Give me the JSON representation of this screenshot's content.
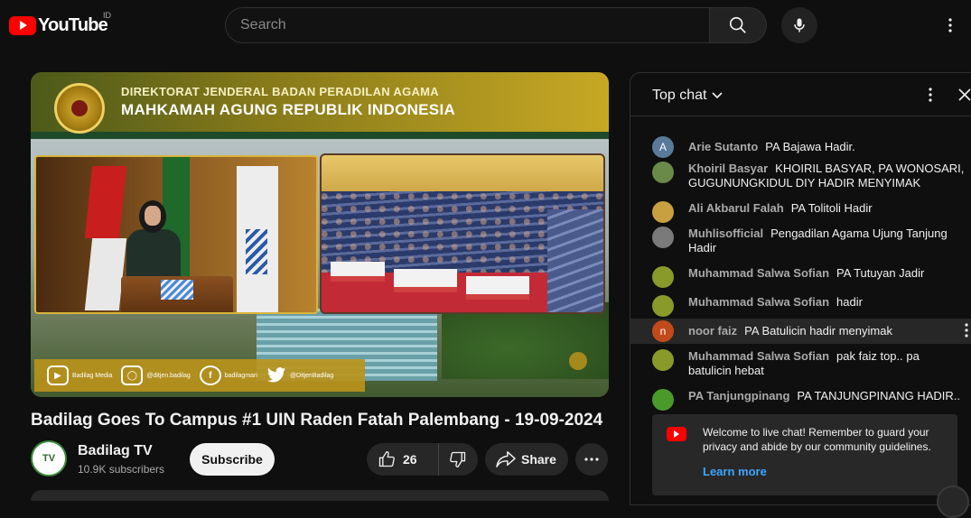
{
  "header": {
    "logo_text": "YouTube",
    "region": "ID",
    "search_placeholder": "Search",
    "search_icon": "search-icon",
    "mic_icon": "mic-icon",
    "menu_icon": "more-vert-icon"
  },
  "player": {
    "banner_line1": "DIREKTORAT JENDERAL BADAN PERADILAN AGAMA",
    "banner_line2": "MAHKAMAH AGUNG REPUBLIK INDONESIA",
    "social": [
      {
        "icon": "play",
        "label": "Badilag Media"
      },
      {
        "icon": "instagram",
        "label": "@ditjen.badilag"
      },
      {
        "icon": "facebook",
        "label": "badilagmari"
      },
      {
        "icon": "twitter",
        "label": "@DitjenBadilag"
      }
    ]
  },
  "video": {
    "title": "Badilag Goes To Campus #1 UIN Raden Fatah Palembang - 19-09-2024"
  },
  "channel": {
    "name": "Badilag TV",
    "subscribers": "10.9K subscribers",
    "subscribe_label": "Subscribe",
    "like_count": "26",
    "share_label": "Share"
  },
  "chat": {
    "title": "Top chat",
    "messages": [
      {
        "author": "Arie Sutanto",
        "text": "PA Bajawa Hadir.",
        "avatar": "A",
        "color": "#5a7a9a"
      },
      {
        "author": "Khoiril Basyar",
        "text": "KHOIRIL BASYAR, PA WONOSARI, GUGUNUNGKIDUL DIY HADIR MENYIMAK",
        "avatar": "",
        "color": "#6a8a4a"
      },
      {
        "author": "Ali Akbarul Falah",
        "text": "PA Tolitoli Hadir",
        "avatar": "",
        "color": "#c8a040"
      },
      {
        "author": "Muhlisofficial",
        "text": "Pengadilan Agama Ujung Tanjung Hadir",
        "avatar": "",
        "color": "#7a7a7a"
      },
      {
        "author": "Muhammad Salwa Sofian",
        "text": "PA Tutuyan Jadir",
        "avatar": "",
        "color": "#8a9a2a"
      },
      {
        "author": "Muhammad Salwa Sofian",
        "text": "hadir",
        "avatar": "",
        "color": "#8a9a2a"
      },
      {
        "author": "noor faiz",
        "text": "PA Batulicin hadir menyimak",
        "avatar": "n",
        "color": "#c24a1a"
      },
      {
        "author": "Muhammad Salwa Sofian",
        "text": "pak faiz top.. pa batulicin hebat",
        "avatar": "",
        "color": "#8a9a2a"
      },
      {
        "author": "PA Tanjungpinang",
        "text": "PA TANJUNGPINANG HADIR..",
        "avatar": "",
        "color": "#4a9a2a"
      }
    ],
    "welcome_text": "Welcome to live chat! Remember to guard your privacy and abide by our community guidelines.",
    "learn_more": "Learn more"
  }
}
